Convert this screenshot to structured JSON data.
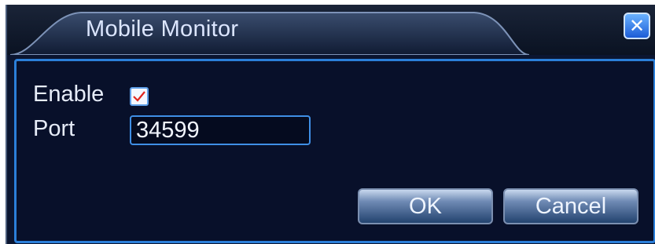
{
  "window": {
    "title": "Mobile Monitor",
    "close_icon": "close-icon"
  },
  "form": {
    "enable_label": "Enable",
    "enable_checked": true,
    "port_label": "Port",
    "port_value": "34599"
  },
  "buttons": {
    "ok_label": "OK",
    "cancel_label": "Cancel"
  },
  "colors": {
    "background": "#0b1530",
    "accent": "#2b7fd9",
    "check": "#e0261f"
  }
}
